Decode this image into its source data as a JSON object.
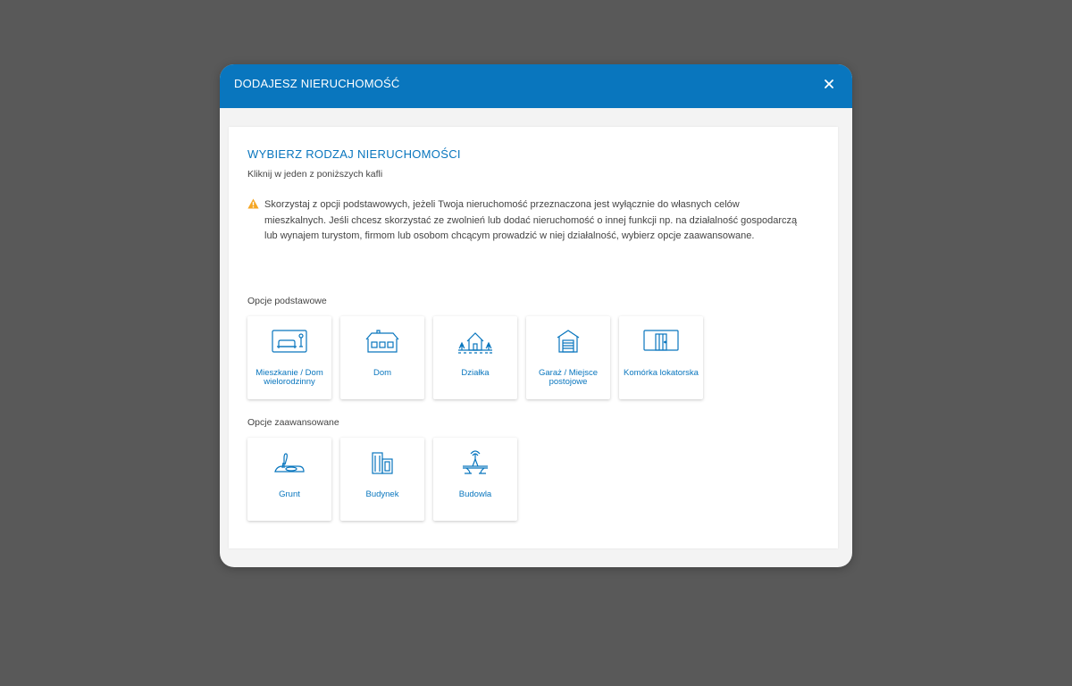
{
  "modal": {
    "title": "DODAJESZ NIERUCHOMOŚĆ",
    "close_icon": "close-icon"
  },
  "panel": {
    "heading": "WYBIERZ RODZAJ NIERUCHOMOŚCI",
    "subheading": "Kliknij w jeden z poniższych kafli",
    "warning_icon": "warning-icon",
    "warning": "Skorzystaj z opcji podstawowych, jeżeli Twoja nieruchomość przeznaczona jest wyłącznie do własnych celów mieszkalnych. Jeśli chcesz skorzystać ze zwolnień lub dodać nieruchomość o innej funkcji np. na działalność gospodarczą lub wynajem turystom, firmom lub osobom chcącym prowadzić w niej działalność, wybierz opcje zaawansowane."
  },
  "basic": {
    "label": "Opcje podstawowe",
    "tiles": [
      {
        "label": "Mieszkanie / Dom wielorodzinny",
        "icon": "apartment-icon"
      },
      {
        "label": "Dom",
        "icon": "house-icon"
      },
      {
        "label": "Działka",
        "icon": "plot-icon"
      },
      {
        "label": "Garaż / Miejsce postojowe",
        "icon": "garage-icon"
      },
      {
        "label": "Komórka lokatorska",
        "icon": "storage-room-icon"
      }
    ]
  },
  "advanced": {
    "label": "Opcje zaawansowane",
    "tiles": [
      {
        "label": "Grunt",
        "icon": "land-icon"
      },
      {
        "label": "Budynek",
        "icon": "building-icon"
      },
      {
        "label": "Budowla",
        "icon": "structure-icon"
      }
    ]
  },
  "colors": {
    "accent": "#0976be",
    "overlay": "#595959",
    "warning": "#f5a623"
  }
}
